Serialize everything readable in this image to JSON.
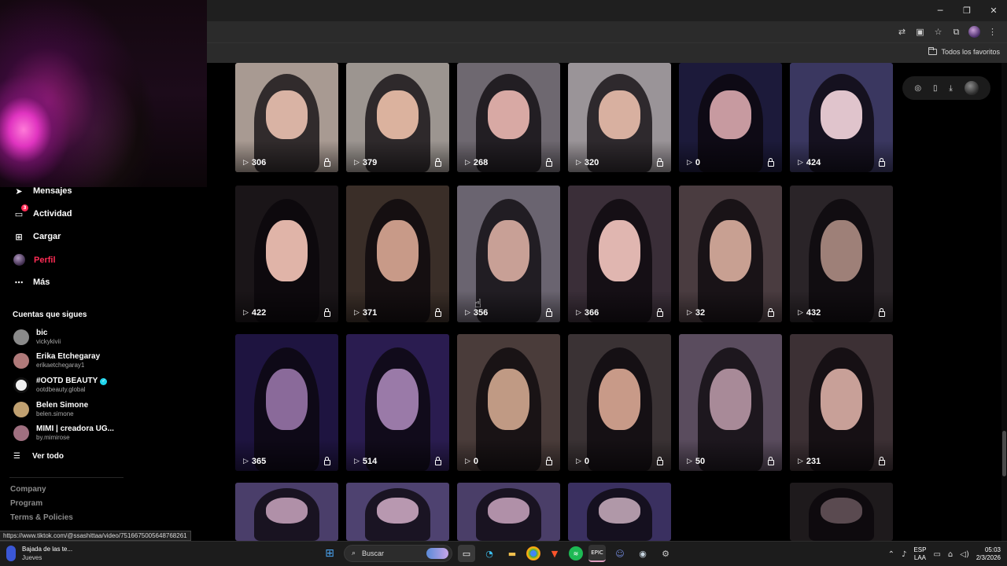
{
  "window": {
    "minimize": "─",
    "restore": "❐",
    "close": "✕"
  },
  "toolbar": {
    "bookmarks_all": "Todos los favoritos"
  },
  "sidebar": {
    "nav": [
      {
        "label": "Mensajes",
        "icon": "paper-plane-icon"
      },
      {
        "label": "Actividad",
        "icon": "chat-bubble-icon",
        "badge": "3"
      },
      {
        "label": "Cargar",
        "icon": "plus-square-icon"
      },
      {
        "label": "Perfil",
        "icon": "avatar"
      },
      {
        "label": "Más",
        "icon": "more-dots-icon"
      }
    ],
    "following_title": "Cuentas que sigues",
    "following": [
      {
        "name": "bic",
        "user": "vickykivii",
        "color": "#8a8a8a",
        "verified": false
      },
      {
        "name": "Erika Etchegaray",
        "user": "erikaetchegaray1",
        "color": "#b07a7a",
        "verified": false
      },
      {
        "name": "#OOTD BEAUTY",
        "user": "ootdbeauty.global",
        "color": "#f0f0f0",
        "verified": true
      },
      {
        "name": "Belen Simone",
        "user": "belen.simone",
        "color": "#c0a070",
        "verified": false
      },
      {
        "name": "MIMI | creadora UG...",
        "user": "by.mimirose",
        "color": "#a07080",
        "verified": false
      }
    ],
    "see_all": "Ver todo",
    "footer": [
      "Company",
      "Program",
      "Terms & Policies"
    ]
  },
  "status_url": "https://www.tiktok.com/@ssashittaa/video/7516675005648768261",
  "videos": [
    {
      "plays": "306",
      "bg": "#a89a92",
      "face": "#d9b3a4"
    },
    {
      "plays": "379",
      "bg": "#9c9590",
      "face": "#dbb29e"
    },
    {
      "plays": "268",
      "bg": "#6e6870",
      "face": "#d8a9a4"
    },
    {
      "plays": "320",
      "bg": "#9a9498",
      "face": "#d8b0a0"
    },
    {
      "plays": "0",
      "bg": "#1c1a3a",
      "face": "#c79aa0"
    },
    {
      "plays": "424",
      "bg": "#3a3760",
      "face": "#e0c4cc"
    },
    {
      "plays": "422",
      "bg": "#1a1518",
      "face": "#e0b4a8"
    },
    {
      "plays": "371",
      "bg": "#3a2e28",
      "face": "#c89a88"
    },
    {
      "plays": "356",
      "bg": "#6a6470",
      "face": "#c8a096"
    },
    {
      "plays": "366",
      "bg": "#3a2e38",
      "face": "#e0b6b0"
    },
    {
      "plays": "32",
      "bg": "#4a3c40",
      "face": "#c8a092"
    },
    {
      "plays": "432",
      "bg": "#2a2428",
      "face": "#9e8078"
    },
    {
      "plays": "365",
      "bg": "#1e1440",
      "face": "#8a6a9a"
    },
    {
      "plays": "514",
      "bg": "#2a1c50",
      "face": "#9a7aa8"
    },
    {
      "plays": "0",
      "bg": "#4a3c3a",
      "face": "#c09a84"
    },
    {
      "plays": "0",
      "bg": "#3a3234",
      "face": "#c89a88"
    },
    {
      "plays": "50",
      "bg": "#5a4c5e",
      "face": "#a88a98"
    },
    {
      "plays": "231",
      "bg": "#3c3034",
      "face": "#c8a098"
    },
    {
      "plays": "",
      "bg": "#4a3e6a",
      "face": "#b090a8"
    },
    {
      "plays": "",
      "bg": "#4e4270",
      "face": "#b898b0"
    },
    {
      "plays": "",
      "bg": "#4a3e68",
      "face": "#b090a8"
    },
    {
      "plays": "",
      "bg": "#3a3060",
      "face": "#b098a8"
    },
    {
      "plays": "",
      "bg": "#000000",
      "face": "#000000"
    },
    {
      "plays": "",
      "bg": "#1e1a1c",
      "face": "#5a4a50"
    }
  ],
  "taskbar": {
    "weather_title": "Bajada de las te...",
    "weather_sub": "Jueves",
    "search_placeholder": "Buscar",
    "lang_top": "ESP",
    "lang_bottom": "LAA",
    "time": "05:03",
    "date": "2/3/2026"
  }
}
